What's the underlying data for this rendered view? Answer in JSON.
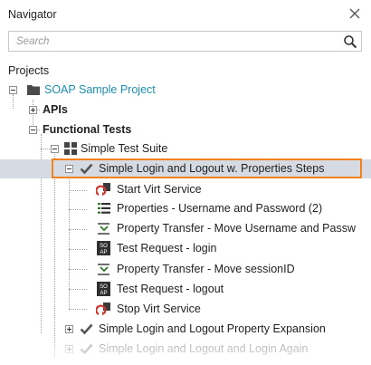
{
  "navigator": {
    "title": "Navigator",
    "search_placeholder": "Search"
  },
  "tree": {
    "section_label": "Projects",
    "project": "SOAP Sample Project",
    "apis": "APIs",
    "functional_tests": "Functional Tests",
    "suite": "Simple Test Suite",
    "testcase_selected": "Simple Login and Logout w. Properties Steps",
    "steps": [
      "Start Virt Service",
      "Properties - Username and Password (2)",
      "Property Transfer - Move Username and Passw",
      "Test Request - login",
      "Property Transfer - Move sessionID",
      "Test Request - logout",
      "Stop Virt Service"
    ],
    "testcase_2": "Simple Login and Logout Property Expansion",
    "testcase_3": "Simple Login and Logout and Login Again"
  },
  "colors": {
    "project_name": "#1a8fb0",
    "selection_border": "#f0831e",
    "selection_fill": "#d6dbe3"
  },
  "icons": {
    "close": "close-icon",
    "search": "search-icon",
    "folder": "folder-icon",
    "suite": "test-suite-icon",
    "testcase": "checkmark-icon",
    "virt_start": "virt-start-icon",
    "properties": "properties-icon",
    "transfer": "property-transfer-icon",
    "request": "soap-request-icon",
    "virt_stop": "virt-stop-icon"
  }
}
